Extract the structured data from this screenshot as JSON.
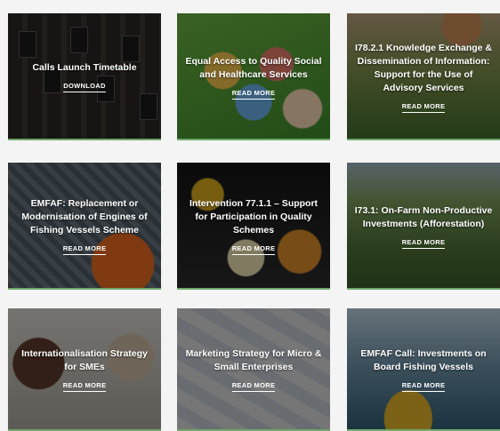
{
  "cards": [
    {
      "title": "Calls Launch Timetable",
      "link": "DOWNLOAD"
    },
    {
      "title": "Equal Access to Quality Social and Healthcare Services",
      "link": "READ MORE"
    },
    {
      "title": "I78.2.1 Knowledge Exchange & Dissemination of Information: Support for the Use of Advisory Services",
      "link": "READ MORE"
    },
    {
      "title": "EMFAF: Replacement or Modernisation of Engines of Fishing Vessels Scheme",
      "link": "READ MORE"
    },
    {
      "title": "Intervention 77.1.1 – Support for Participation in Quality Schemes",
      "link": "READ MORE"
    },
    {
      "title": "I73.1: On-Farm Non-Productive Investments (Afforestation)",
      "link": "READ MORE"
    },
    {
      "title": "Internationalisation Strategy for SMEs",
      "link": "READ MORE"
    },
    {
      "title": "Marketing Strategy for Micro & Small Enterprises",
      "link": "READ MORE"
    },
    {
      "title": "EMFAF Call: Investments on Board Fishing Vessels",
      "link": "READ MORE"
    }
  ],
  "colors": {
    "accent_line": "#6fa86b",
    "overlay": "rgba(0,0,0,0.45)",
    "text": "#ffffff"
  }
}
